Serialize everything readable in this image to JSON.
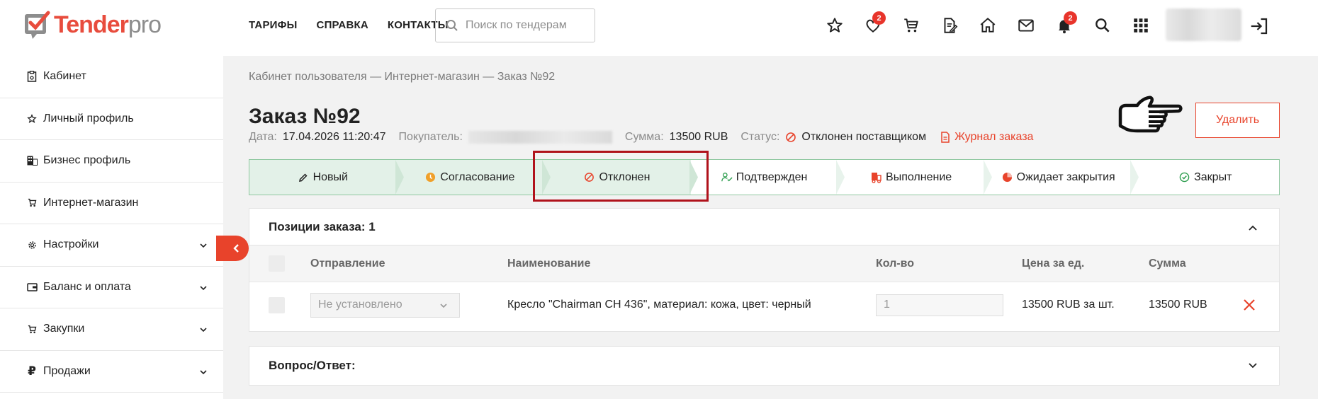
{
  "header": {
    "logo_brand": "Tender",
    "logo_suffix": "pro",
    "nav": [
      "ТАРИФЫ",
      "СПРАВКА",
      "КОНТАКТЫ"
    ],
    "search_placeholder": "Поиск по тендерам",
    "favorites_badge": "2",
    "notifications_badge": "2"
  },
  "sidebar": {
    "items": [
      {
        "label": "Кабинет",
        "icon": "cabinet-icon",
        "expandable": false
      },
      {
        "label": "Личный профиль",
        "icon": "star-icon",
        "expandable": false
      },
      {
        "label": "Бизнес профиль",
        "icon": "building-icon",
        "expandable": false
      },
      {
        "label": "Интернет-магазин",
        "icon": "cart-icon",
        "expandable": false
      },
      {
        "label": "Настройки",
        "icon": "gear-icon",
        "expandable": true
      },
      {
        "label": "Баланс и оплата",
        "icon": "wallet-icon",
        "expandable": true
      },
      {
        "label": "Закупки",
        "icon": "cart-icon",
        "expandable": true
      },
      {
        "label": "Продажи",
        "icon": "ruble-icon",
        "expandable": true
      }
    ]
  },
  "breadcrumb": "Кабинет пользователя — Интернет-магазин — Заказ №92",
  "order": {
    "title": "Заказ №92",
    "date_label": "Дата:",
    "date_value": "17.04.2026 11:20:47",
    "buyer_label": "Покупатель:",
    "sum_label": "Сумма:",
    "sum_value": "13500 RUB",
    "status_label": "Статус:",
    "status_value": "Отклонен поставщиком",
    "journal_label": "Журнал заказа",
    "delete_label": "Удалить"
  },
  "steps": [
    {
      "label": "Новый",
      "icon": "pencil-icon",
      "state": "done"
    },
    {
      "label": "Согласование",
      "icon": "clock-icon",
      "state": "done"
    },
    {
      "label": "Отклонен",
      "icon": "ban-icon",
      "state": "current"
    },
    {
      "label": "Подтвержден",
      "icon": "user-check-icon",
      "state": "pending"
    },
    {
      "label": "Выполнение",
      "icon": "truck-icon",
      "state": "pending"
    },
    {
      "label": "Ожидает закрытия",
      "icon": "pie-icon",
      "state": "pending"
    },
    {
      "label": "Закрыт",
      "icon": "check-circle-icon",
      "state": "pending"
    }
  ],
  "positions": {
    "title": "Позиции заказа: 1",
    "columns": [
      "Отправление",
      "Наименование",
      "Кол-во",
      "Цена за ед.",
      "Сумма"
    ],
    "rows": [
      {
        "shipment": "Не установлено",
        "name": "Кресло \"Chairman CH 436\", материал: кожа, цвет: черный",
        "qty": "1",
        "price": "13500 RUB за шт.",
        "sum": "13500 RUB"
      }
    ]
  },
  "qa": {
    "title": "Вопрос/Ответ:"
  },
  "colors": {
    "accent": "#e8432b",
    "step_done_bg": "#e3f1e8",
    "step_border": "#8fc7a0",
    "highlight": "#b0121b"
  }
}
